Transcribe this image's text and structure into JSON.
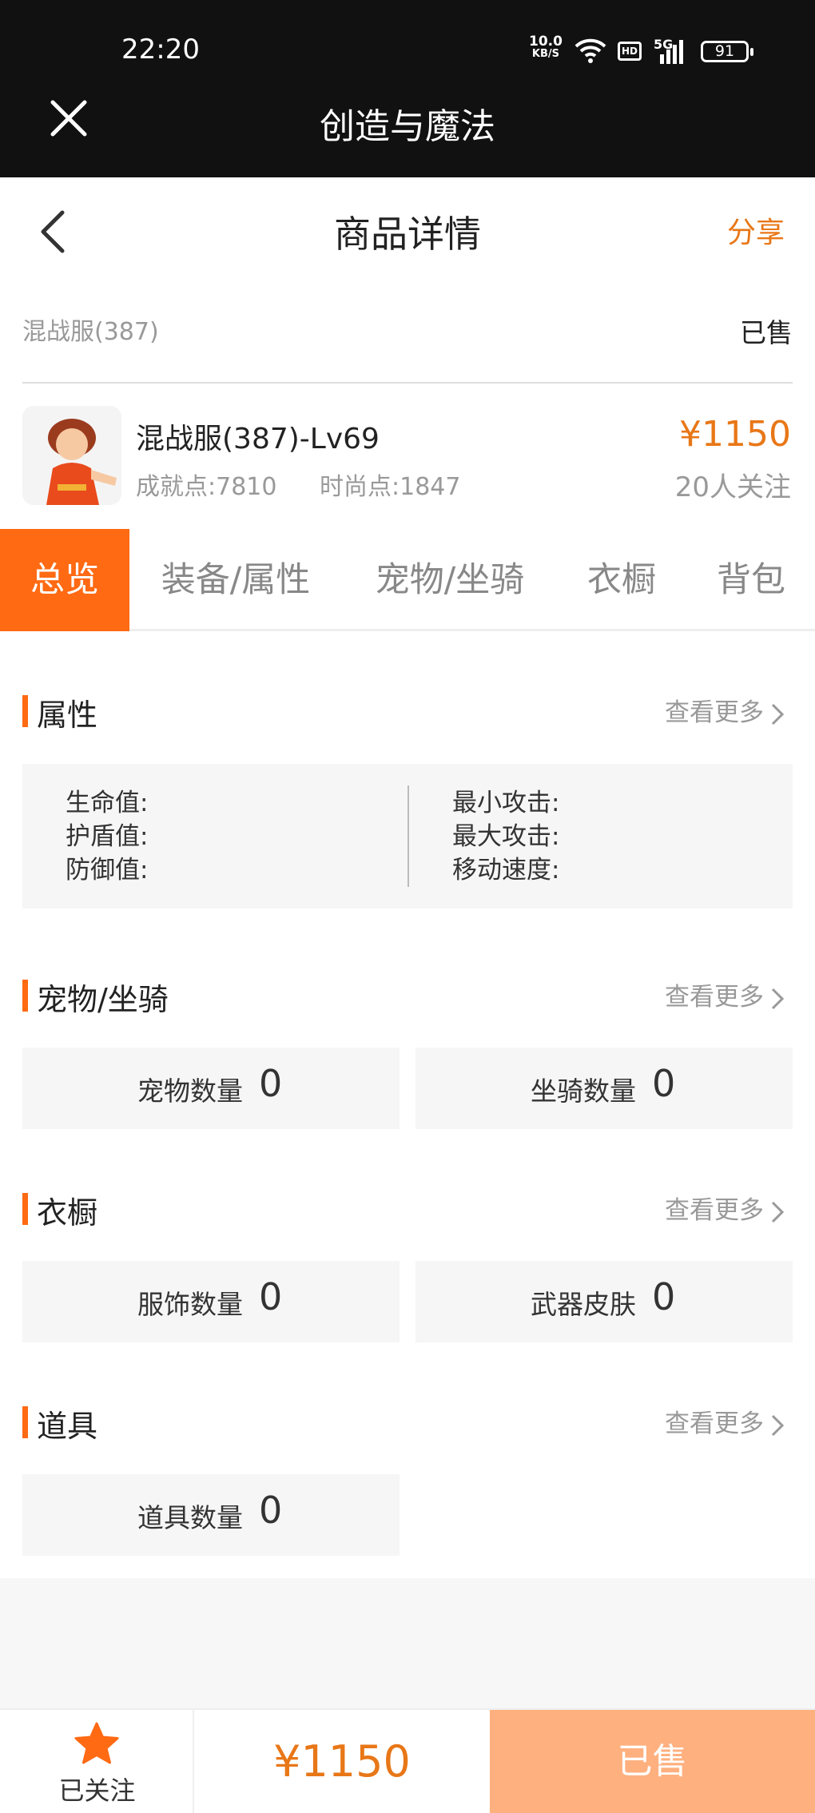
{
  "status_bar": {
    "time": "22:20",
    "net_speed": "10.0",
    "net_unit": "KB/S",
    "hd": "HD",
    "signal": "5G",
    "battery": "91"
  },
  "app": {
    "title": "创造与魔法"
  },
  "nav": {
    "title": "商品详情",
    "share": "分享"
  },
  "server": {
    "name": "混战服(387)",
    "status": "已售"
  },
  "product": {
    "name": "混战服(387)-Lv69",
    "achievement": "成就点:7810",
    "fashion": "时尚点:1847",
    "price": "¥1150",
    "watchers": "20人关注"
  },
  "tabs": [
    {
      "label": "总览",
      "active": true
    },
    {
      "label": "装备/属性",
      "active": false
    },
    {
      "label": "宠物/坐骑",
      "active": false
    },
    {
      "label": "衣橱",
      "active": false
    },
    {
      "label": "背包",
      "active": false
    }
  ],
  "more_label": "查看更多",
  "attributes": {
    "title": "属性",
    "left": [
      "生命值:",
      "护盾值:",
      "防御值:"
    ],
    "right": [
      "最小攻击:",
      "最大攻击:",
      "移动速度:"
    ]
  },
  "pets": {
    "title": "宠物/坐骑",
    "items": [
      {
        "label": "宠物数量",
        "value": "0"
      },
      {
        "label": "坐骑数量",
        "value": "0"
      }
    ]
  },
  "wardrobe": {
    "title": "衣橱",
    "items": [
      {
        "label": "服饰数量",
        "value": "0"
      },
      {
        "label": "武器皮肤",
        "value": "0"
      }
    ]
  },
  "props": {
    "title": "道具",
    "items": [
      {
        "label": "道具数量",
        "value": "0"
      }
    ]
  },
  "bottom": {
    "follow": "已关注",
    "price": "¥1150",
    "sold": "已售"
  },
  "colors": {
    "accent": "#ff6a13",
    "price": "#e87717",
    "sold_button": "#ffb07f"
  }
}
